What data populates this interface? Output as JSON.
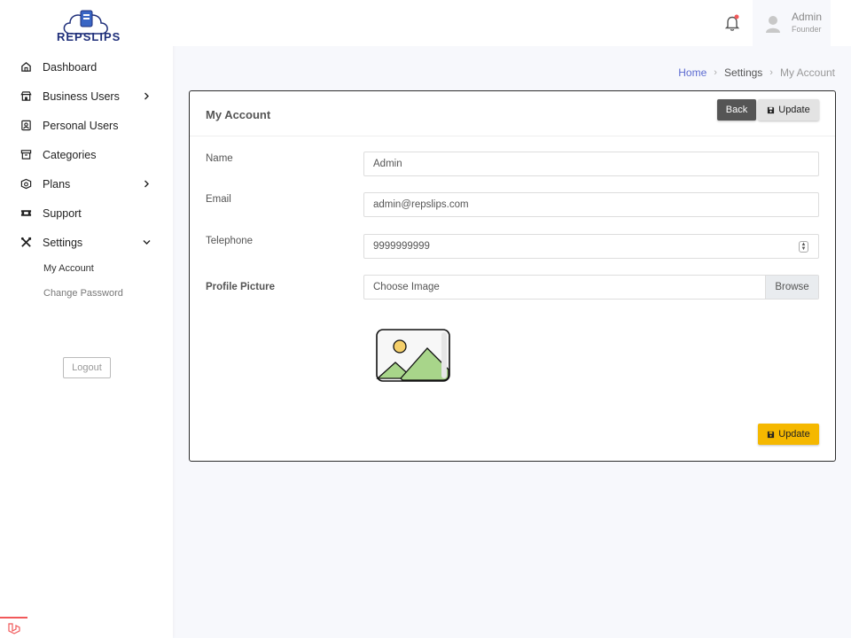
{
  "brand": {
    "name": "REPSLIPS"
  },
  "sidebar": {
    "items": [
      {
        "label": "Dashboard",
        "icon": "home-icon",
        "chevron": false
      },
      {
        "label": "Business Users",
        "icon": "store-icon",
        "chevron": true
      },
      {
        "label": "Personal Users",
        "icon": "id-card-icon",
        "chevron": false
      },
      {
        "label": "Categories",
        "icon": "archive-icon",
        "chevron": false
      },
      {
        "label": "Plans",
        "icon": "box-icon",
        "chevron": true
      },
      {
        "label": "Support",
        "icon": "ticket-icon",
        "chevron": false
      },
      {
        "label": "Settings",
        "icon": "tools-icon",
        "chevron": "down"
      }
    ],
    "settings_sub": [
      {
        "label": "My Account",
        "active": true
      },
      {
        "label": "Change Password",
        "active": false
      }
    ],
    "logout_label": "Logout"
  },
  "header": {
    "user_name": "Admin",
    "user_role": "Founder",
    "notification_color": "#f1595a"
  },
  "breadcrumb": {
    "home": "Home",
    "section": "Settings",
    "current": "My Account"
  },
  "card": {
    "title": "My Account",
    "back_label": "Back",
    "update_label": "Update",
    "fields": {
      "name_label": "Name",
      "name_value": "Admin",
      "email_label": "Email",
      "email_value": "admin@repslips.com",
      "telephone_label": "Telephone",
      "telephone_value": "9999999999",
      "picture_label": "Profile Picture",
      "picture_placeholder": "Choose Image",
      "browse_label": "Browse"
    }
  },
  "colors": {
    "accent_link": "#5b6ad0",
    "update_primary": "#f5b800",
    "back_button": "#555555",
    "brand_blue": "#1f2f7a"
  }
}
